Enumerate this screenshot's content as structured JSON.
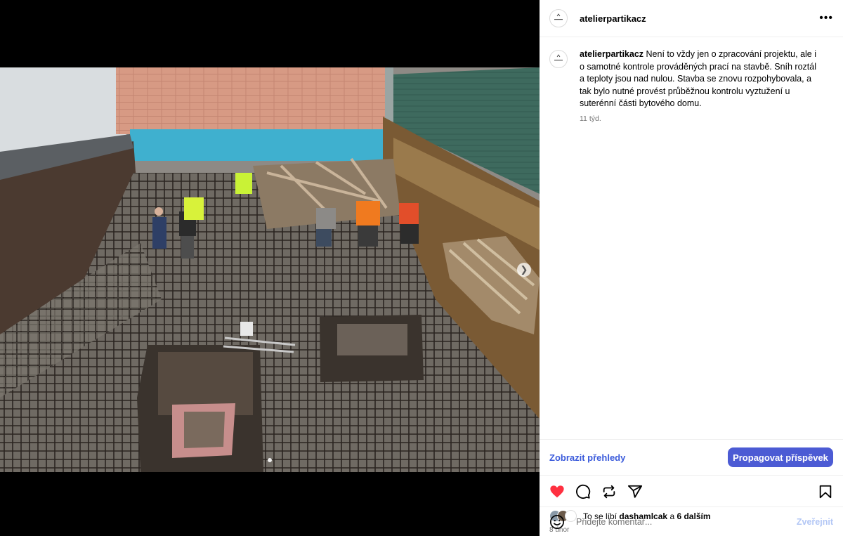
{
  "post": {
    "username": "atelierpartikacz",
    "more_icon": "more-horizontal-icon",
    "caption_user": "atelierpartikacz",
    "caption_text": "Není to vždy jen o zpracování projektu, ale i o samotné kontrole prováděných prací na stavbě. Sníh roztál a teploty jsou nad nulou. Stavba se znovu rozpohybovala, a tak bylo nutné provést průběžnou kontrolu vyztužení u suterénní části bytového domu.",
    "caption_time": "11 týd."
  },
  "insights": {
    "view_insights": "Zobrazit přehledy",
    "promote": "Propagovat příspěvek"
  },
  "actions": {
    "liked": true,
    "like_icon": "heart-icon",
    "comment_icon": "comment-icon",
    "share_icon": "repost-icon",
    "send_icon": "send-icon",
    "save_icon": "bookmark-icon",
    "like_color": "#ff3040"
  },
  "likes": {
    "prefix": "To se líbí",
    "user": "dashamlcak",
    "conj": "a",
    "others": "6 dalším"
  },
  "date": "8 únor",
  "comment": {
    "placeholder": "Přidejte komentář...",
    "post_label": "Zveřejnit",
    "emoji_icon": "emoji-icon"
  },
  "carousel": {
    "current": 1,
    "total": 2,
    "next_icon": "chevron-right-icon"
  },
  "colors": {
    "accent": "#4c5bd4",
    "link": "#3b5bdb"
  }
}
